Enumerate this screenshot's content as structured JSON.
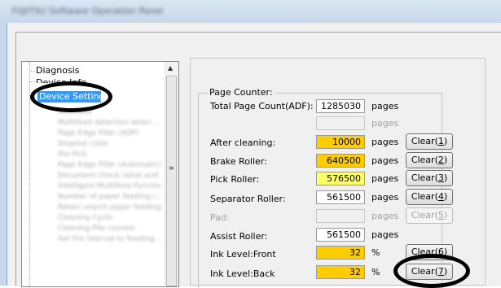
{
  "window": {
    "title": "FUJITSU Software Operation Panel"
  },
  "tree": {
    "items": [
      {
        "label": "Diagnosis"
      },
      {
        "label": "Device Info"
      },
      {
        "label": "Device Setting",
        "selected": true
      }
    ],
    "children": [
      "Multifeed",
      "Multifeed detection when ...",
      "Page Edge Filler (ADF)",
      "Dropout color",
      "Pre-Pick",
      "Page Edge Filler (Automatic)",
      "Document check value and ...",
      "Intelligent Multifeed Functio...",
      "Number of paper feeding r...",
      "Retain unpick paper feeding",
      "Cleaning Cycle",
      "Cleaning Pile counter",
      "Set the interval to feeding..."
    ]
  },
  "page_counter": {
    "group_title": "Page Counter:",
    "rows": [
      {
        "label": "Total Page Count(ADF):",
        "value": "1285030",
        "unit": "pages"
      },
      {
        "label": "",
        "value": "",
        "unit": "pages",
        "disabled": true
      },
      {
        "label": "After cleaning:",
        "value": "10000",
        "unit": "pages",
        "button": "Clear(1)",
        "highlight": "#ffcc00"
      },
      {
        "label": "Brake Roller:",
        "value": "640500",
        "unit": "pages",
        "button": "Clear(2)",
        "highlight": "#ffcc00"
      },
      {
        "label": "Pick Roller:",
        "value": "576500",
        "unit": "pages",
        "button": "Clear(3)",
        "highlight": "#ffff66"
      },
      {
        "label": "Separator Roller:",
        "value": "561500",
        "unit": "pages",
        "button": "Clear(4)"
      },
      {
        "label": "Pad:",
        "value": "",
        "unit": "pages",
        "button": "Clear(5)",
        "disabled": true
      },
      {
        "label": "Assist Roller:",
        "value": "561500",
        "unit": "pages"
      },
      {
        "label": "Ink Level:Front",
        "value": "32",
        "unit": "%",
        "button": "Clear(6)",
        "highlight": "#ffcc00"
      },
      {
        "label": "Ink Level:Back",
        "value": "32",
        "unit": "%",
        "button": "Clear(7)",
        "highlight": "#ffcc00"
      }
    ]
  },
  "buttons": {
    "clear1": {
      "pre": "Clear(",
      "key": "1",
      "post": ")"
    },
    "clear2": {
      "pre": "Clear(",
      "key": "2",
      "post": ")"
    },
    "clear3": {
      "pre": "Clear(",
      "key": "3",
      "post": ")"
    },
    "clear4": {
      "pre": "Clear(",
      "key": "4",
      "post": ")"
    },
    "clear5": {
      "pre": "Clear(",
      "key": "5",
      "post": ")"
    },
    "clear6": {
      "pre": "Clear(",
      "key": "6",
      "post": ")"
    },
    "clear7": {
      "pre": "Clear(",
      "key": "7",
      "post": ")"
    }
  },
  "colors": {
    "highlight_orange": "#ffcc00",
    "highlight_yellow": "#ffff66",
    "tree_selection": "#3399ff",
    "annotation": "#000000"
  },
  "icons": {
    "scroll_up": "▲",
    "scroll_grip": "≡"
  }
}
